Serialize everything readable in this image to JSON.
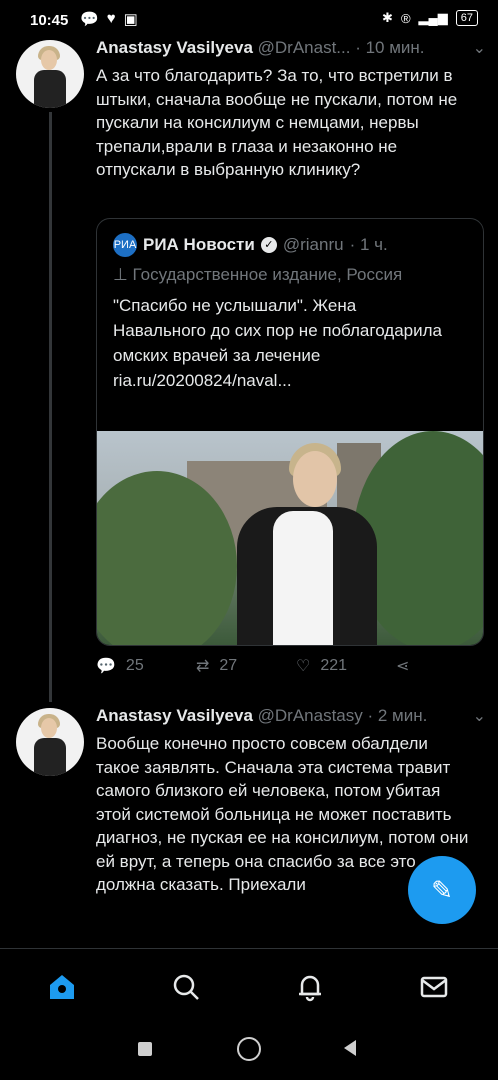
{
  "status_bar": {
    "time": "10:45",
    "battery": "67"
  },
  "tweets": [
    {
      "name": "Anastasy Vasilyeva",
      "handle": "@DrAnast...",
      "time": "· 10 мин.",
      "text": "А за что благодарить? За то, что встретили в штыки, сначала вообще не пускали, потом не пускали на консилиум с немцами, нервы трепали,врали в глаза и незаконно не отпускали в выбранную клинику?",
      "quote": {
        "logo_text": "РИА",
        "name": "РИА Новости",
        "handle": "@rianru",
        "time": "· 1 ч.",
        "label": "Государственное издание, Россия",
        "text": "\"Спасибо не услышали\". Жена Навального до сих пор не поблагодарила омских врачей за лечение",
        "link": "ria.ru/20200824/naval..."
      },
      "replies": "25",
      "retweets": "27",
      "likes": "221"
    },
    {
      "name": "Anastasy Vasilyeva",
      "handle": "@DrAnastasy",
      "time": "· 2 мин.",
      "text": "Вообще конечно просто совсем обалдели такое заявлять. Сначала эта система травит самого близкого ей человека, потом убитая этой системой больница не может поставить диагноз, не пуская ее на консилиум, потом они ей врут, а теперь она спасибо за все это должна сказать. Приехали"
    }
  ],
  "colors": {
    "accent": "#1d9bf0",
    "muted": "#71767b",
    "background": "#000000"
  }
}
